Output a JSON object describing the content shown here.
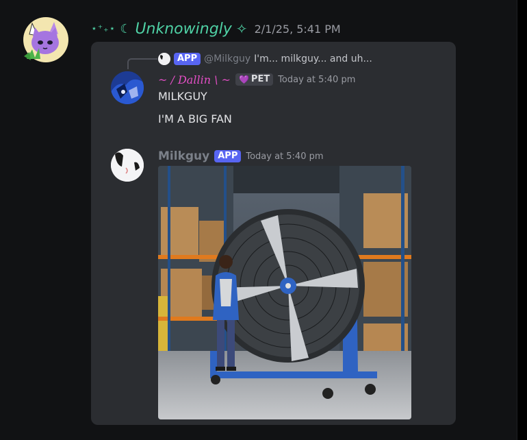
{
  "outer_message": {
    "decor_left": "⋆⁺₊⋆",
    "moon": "☾",
    "author": "Unknowingly",
    "star": "✧",
    "timestamp": "2/1/25, 5:41 PM"
  },
  "reply_reference": {
    "badge": "APP",
    "user": "@Milkguy",
    "text": "I'm... milkguy... and uh..."
  },
  "messages": [
    {
      "author": "~ / Dallin \\ ~",
      "badge": "PET",
      "badge_icon": "heart-icon",
      "timestamp": "Today at 5:40 pm",
      "lines": [
        "MILKGUY",
        "I'M A BIG FAN"
      ]
    },
    {
      "author": "Milkguy",
      "badge": "APP",
      "timestamp": "Today at 5:40 pm",
      "attachment": "warehouse-fan-photo"
    }
  ],
  "colors": {
    "accent_name": "#4fd1a5",
    "dallin_name": "#e54fc7",
    "app_badge": "#5865f2",
    "embed_bg": "#2b2d31",
    "page_bg": "#111214"
  }
}
